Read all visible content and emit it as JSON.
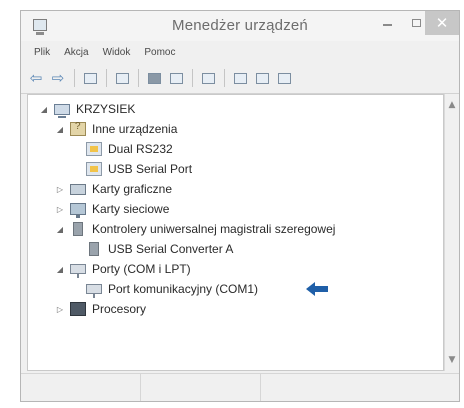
{
  "window": {
    "title": "Menedżer urządzeń",
    "icons": {
      "app": "device-manager-icon",
      "minimize": "minimize-icon",
      "maximize": "maximize-icon",
      "close": "close-icon"
    },
    "close_glyph": "✕"
  },
  "menu": [
    "Plik",
    "Akcja",
    "Widok",
    "Pomoc"
  ],
  "toolbar": {
    "icons": [
      "back-icon",
      "forward-icon",
      "properties-icon",
      "view-icon",
      "help-icon",
      "show-icon",
      "scan-icon",
      "update-driver-icon",
      "disable-icon",
      "uninstall-icon"
    ],
    "back_glyph": "⇦",
    "forward_glyph": "⇨"
  },
  "tree": [
    {
      "label": "KRZYSIEK",
      "expander": "◢",
      "icon": "computer-icon"
    },
    {
      "label": "Inne urządzenia",
      "expander": "◢",
      "icon": "unknown-device-icon"
    },
    {
      "label": "Dual RS232",
      "expander": "",
      "icon": "device-icon"
    },
    {
      "label": "USB Serial Port",
      "expander": "",
      "icon": "device-icon"
    },
    {
      "label": "Karty graficzne",
      "expander": "▷",
      "icon": "graphics-card-icon"
    },
    {
      "label": "Karty sieciowe",
      "expander": "▷",
      "icon": "network-adapter-icon"
    },
    {
      "label": "Kontrolery uniwersalnej magistrali szeregowej",
      "expander": "◢",
      "icon": "usb-controller-icon"
    },
    {
      "label": "USB Serial Converter A",
      "expander": "",
      "icon": "usb-device-icon"
    },
    {
      "label": "Porty (COM i LPT)",
      "expander": "◢",
      "icon": "port-icon"
    },
    {
      "label": "Port komunikacyjny (COM1)",
      "expander": "",
      "icon": "port-icon"
    },
    {
      "label": "Procesory",
      "expander": "▷",
      "icon": "processor-icon"
    }
  ],
  "scrollbar": {
    "up_glyph": "▲",
    "down_glyph": "▼"
  },
  "annotation": {
    "arrow_color": "#1f5fa8",
    "icon": "pointer-arrow-icon"
  }
}
